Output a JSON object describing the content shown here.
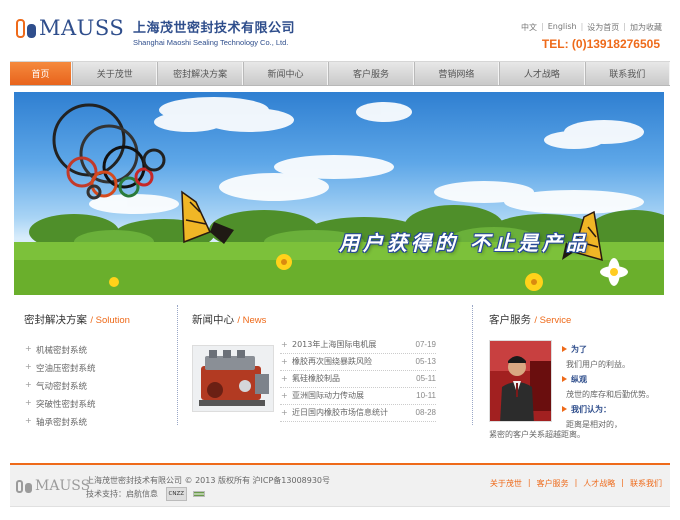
{
  "header": {
    "logo_text": "MAUSS",
    "company_cn": "上海茂世密封技术有限公司",
    "company_en": "Shanghai Maoshi Sealing Technology Co., Ltd.",
    "top_links": [
      "中文",
      "English",
      "设为首页",
      "加为收藏"
    ],
    "phone": "TEL: (0)13918276505"
  },
  "nav": {
    "items": [
      "首页",
      "关于茂世",
      "密封解决方案",
      "新闻中心",
      "客户服务",
      "营销网络",
      "人才战略",
      "联系我们"
    ]
  },
  "banner": {
    "slogan": "用户获得的 不止是产品"
  },
  "solutions": {
    "title": "密封解决方案",
    "subtitle": "/ Solution",
    "items": [
      "机械密封系统",
      "空油压密封系统",
      "气动密封系统",
      "突破性密封系统",
      "轴承密封系统"
    ]
  },
  "news": {
    "title": "新闻中心",
    "subtitle": "/ News",
    "items": [
      {
        "title": "2013年上海国际电机展",
        "date": "07-19"
      },
      {
        "title": "橡胶再次围绕暴跌风险",
        "date": "05-13"
      },
      {
        "title": "氟硅橡胶制品",
        "date": "05-11"
      },
      {
        "title": "亚洲国际动力传动展",
        "date": "10-11"
      },
      {
        "title": "近日国内橡胶市场信息统计",
        "date": "08-28"
      }
    ]
  },
  "service": {
    "title": "客户服务",
    "subtitle": "/ Service",
    "lines": [
      {
        "head": "为了",
        "text": "我们用户的利益。"
      },
      {
        "head": "纵观",
        "text": "茂世的库存和后勤优势。"
      },
      {
        "head": "我们认为：",
        "text": "距离是相对的，"
      }
    ],
    "last_line": "紧密的客户关系超越距离。"
  },
  "footer": {
    "logo_text": "MAUSS",
    "copyright": "上海茂世密封技术有限公司 © 2013 版权所有 沪ICP备13008930号",
    "support": "技术支持：启航信息",
    "badge": "CNZZ",
    "links": [
      "关于茂世",
      "客户服务",
      "人才战略",
      "联系我们"
    ]
  },
  "colors": {
    "accent": "#ee6a1a",
    "brand": "#2f4e8c"
  }
}
